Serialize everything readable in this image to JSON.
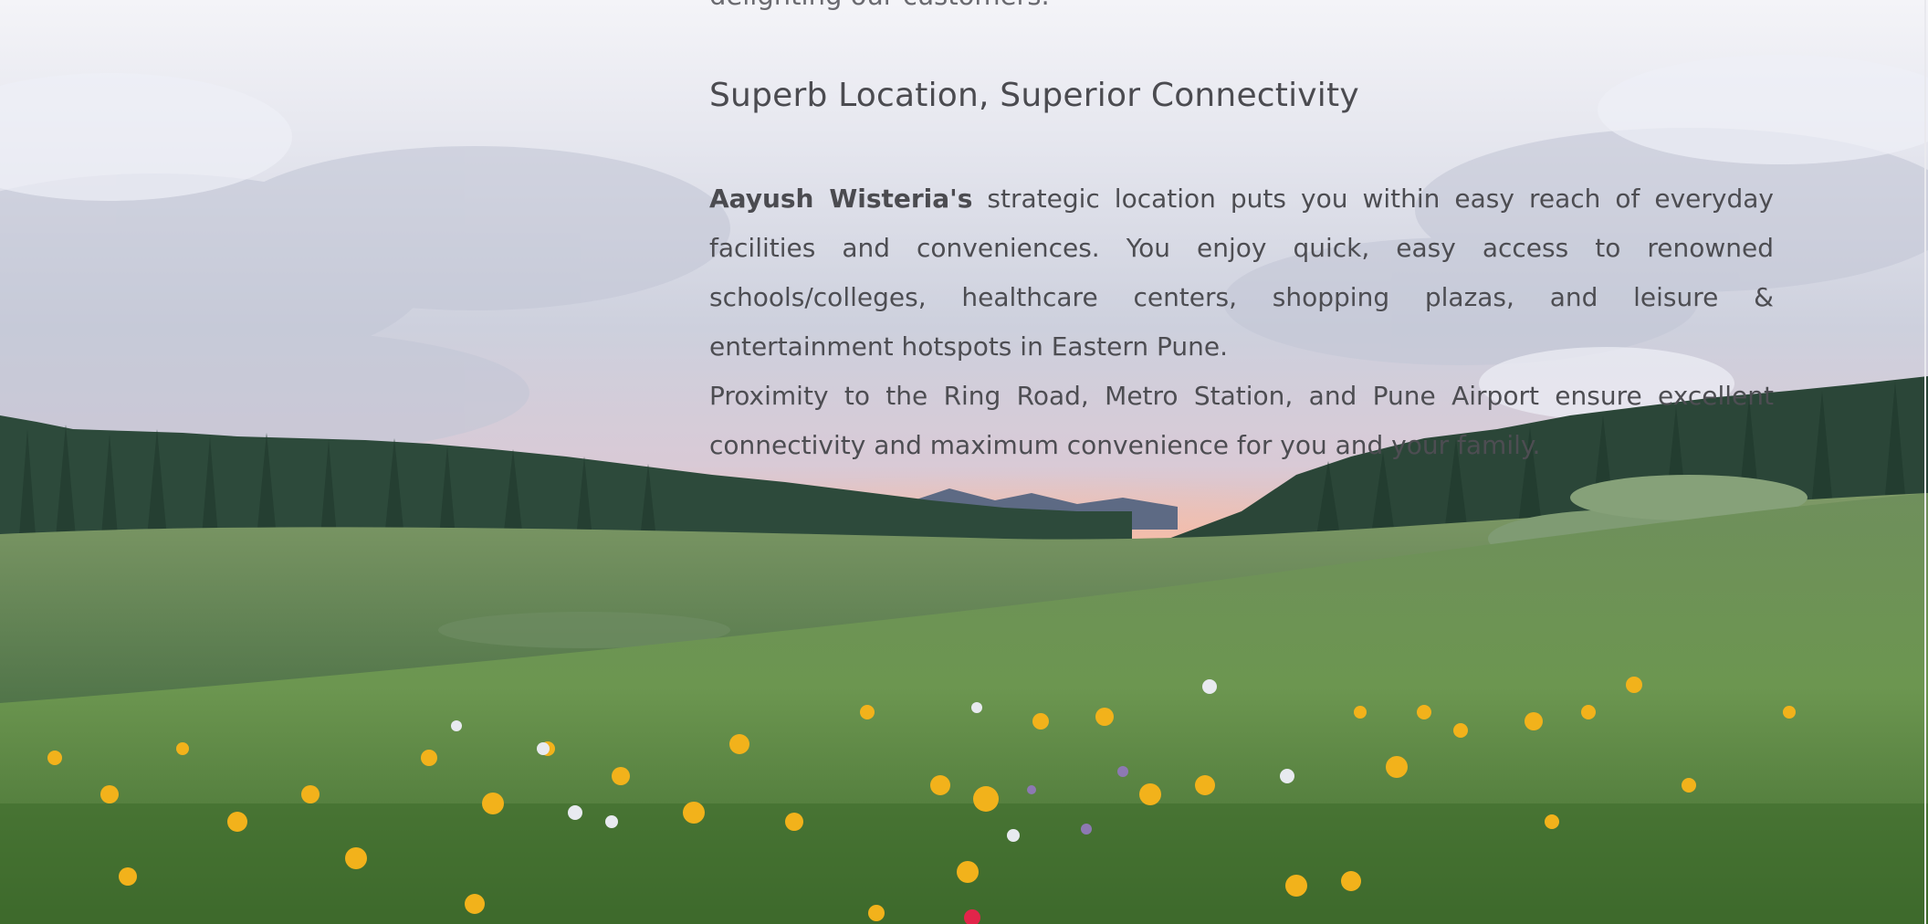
{
  "previous_line_fragment": "delighting our customers.",
  "section": {
    "title": "Superb Location, Superior Connectivity",
    "brand_name": "Aayush Wisteria's",
    "paragraph_1": " strategic location puts you within easy reach of everyday facilities and conveniences. You enjoy quick, easy access to renowned schools/colleges, healthcare centers, shopping plazas, and leisure & entertainment hotspots in Eastern Pune.",
    "paragraph_2": "Proximity to the Ring Road, Metro Station, and Pune Airport ensure excellent connectivity and maximum convenience for you and your family."
  },
  "colors": {
    "sky_top": "#f2f1f6",
    "cloud": "#cfd2de",
    "sunset": "#f4b7a6",
    "forest": "#2f4a3c",
    "meadow": "#5f8a4a",
    "flower_yellow": "#f2b21b",
    "text": "#4b4b50"
  }
}
